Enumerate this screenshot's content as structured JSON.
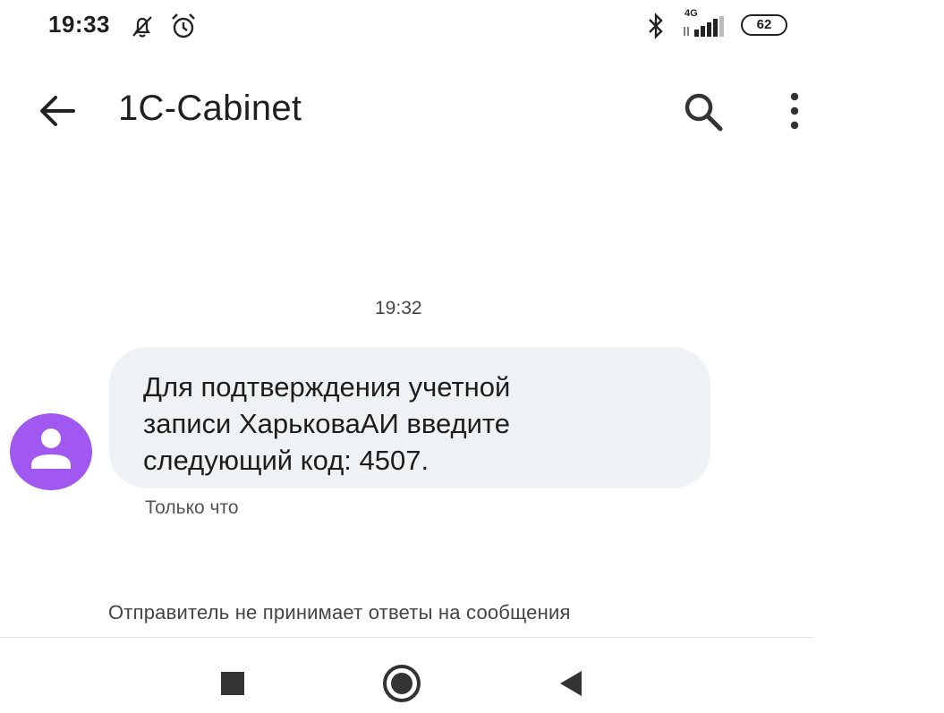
{
  "status_bar": {
    "time": "19:33",
    "network": "4G",
    "battery": "62",
    "icons": [
      "bell-off-icon",
      "alarm-icon",
      "bluetooth-icon",
      "signal-icon",
      "battery-icon"
    ]
  },
  "app_bar": {
    "title": "1C-Cabinet",
    "icons": [
      "back-arrow-icon",
      "search-icon",
      "more-vert-icon"
    ]
  },
  "conversation": {
    "timestamp": "19:32",
    "message": {
      "text": "Для подтверждения учетной\nзаписи ХарьковаАИ введите\nследующий код: 4507.",
      "status": "Только что"
    },
    "sender_notice": "Отправитель не принимает ответы на сообщения"
  },
  "colors": {
    "avatar": "#a158f0",
    "bubble": "#eff2f5"
  },
  "nav_bar": {
    "icons": [
      "recents-square-icon",
      "home-circle-icon",
      "back-triangle-icon"
    ]
  }
}
